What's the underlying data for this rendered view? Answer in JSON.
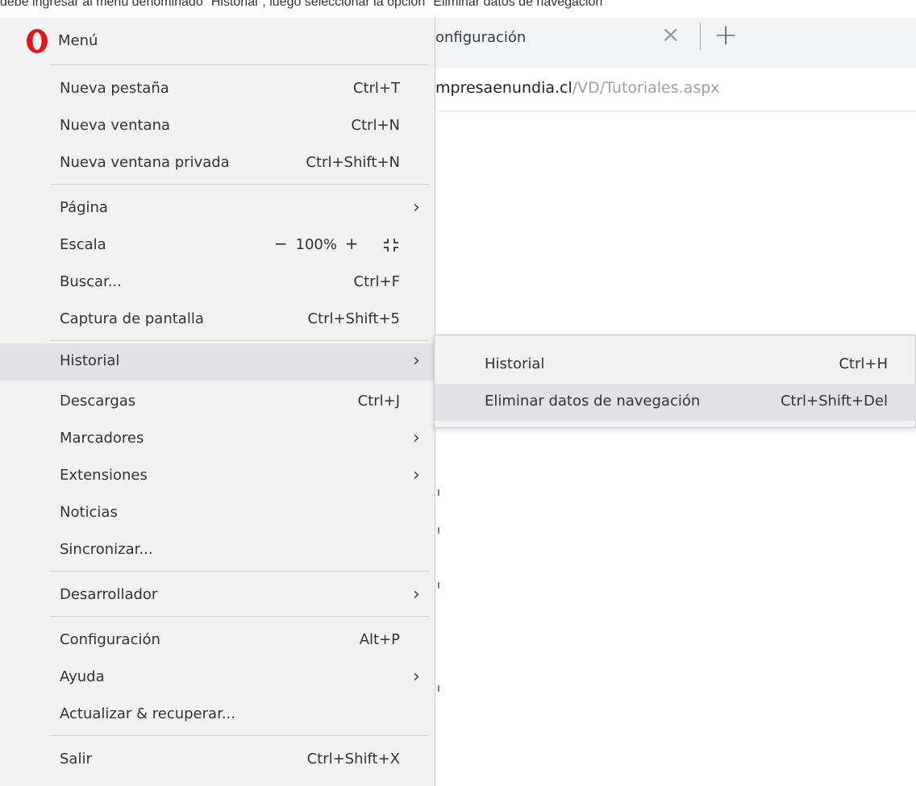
{
  "instruction_text": "debe ingresar al menú denominado \"Historial\", luego seleccionar la opción \"Eliminar datos de navegación\"",
  "browser": {
    "tab_title": "onfiguración",
    "address_domain": "mpresaenundia.cl",
    "address_path": "/VD/Tutoriales.aspx"
  },
  "menu": {
    "title": "Menú",
    "items": [
      {
        "label": "Nueva pestaña",
        "shortcut": "Ctrl+T"
      },
      {
        "label": "Nueva ventana",
        "shortcut": "Ctrl+N"
      },
      {
        "label": "Nueva ventana privada",
        "shortcut": "Ctrl+Shift+N"
      },
      {
        "label": "Página",
        "shortcut": ""
      },
      {
        "label": "Escala",
        "shortcut": ""
      },
      {
        "label": "Buscar...",
        "shortcut": "Ctrl+F"
      },
      {
        "label": "Captura de pantalla",
        "shortcut": "Ctrl+Shift+5"
      },
      {
        "label": "Historial",
        "shortcut": ""
      },
      {
        "label": "Descargas",
        "shortcut": "Ctrl+J"
      },
      {
        "label": "Marcadores",
        "shortcut": ""
      },
      {
        "label": "Extensiones",
        "shortcut": ""
      },
      {
        "label": "Noticias",
        "shortcut": ""
      },
      {
        "label": "Sincronizar...",
        "shortcut": ""
      },
      {
        "label": "Desarrollador",
        "shortcut": ""
      },
      {
        "label": "Configuración",
        "shortcut": "Alt+P"
      },
      {
        "label": "Ayuda",
        "shortcut": ""
      },
      {
        "label": "Actualizar & recuperar...",
        "shortcut": ""
      },
      {
        "label": "Salir",
        "shortcut": "Ctrl+Shift+X"
      }
    ],
    "zoom": {
      "minus": "−",
      "value": "100%",
      "plus": "+"
    }
  },
  "submenu": {
    "items": [
      {
        "label": "Historial",
        "shortcut": "Ctrl+H"
      },
      {
        "label": "Eliminar datos de navegación",
        "shortcut": "Ctrl+Shift+Del"
      }
    ]
  },
  "colors": {
    "opera_red": "#e0151d",
    "menu_bg": "#f2f2f2",
    "highlight_bg": "#e2e2e6"
  }
}
